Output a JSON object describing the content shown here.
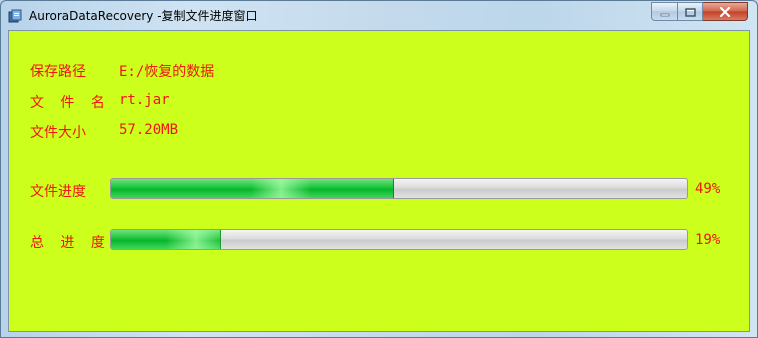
{
  "window": {
    "title": "AuroraDataRecovery -复制文件进度窗口",
    "buttons": {
      "minimize": "minimize-icon",
      "maximize": "maximize-icon",
      "close": "close-icon"
    }
  },
  "info": {
    "save_path_label": "保存路径",
    "save_path_value": "E:/恢复的数据",
    "file_name_label": "文 件 名",
    "file_name_value": "rt.jar",
    "file_size_label": "文件大小",
    "file_size_value": "57.20MB"
  },
  "progress": {
    "file_label": "文件进度",
    "file_percent_text": "49%",
    "file_value": 0.49,
    "total_label": "总 进 度",
    "total_percent_text": "19%",
    "total_value": 0.19
  },
  "colors": {
    "background": "#cdff1c",
    "text": "#f01616",
    "progress_fill": "#19c33a"
  }
}
